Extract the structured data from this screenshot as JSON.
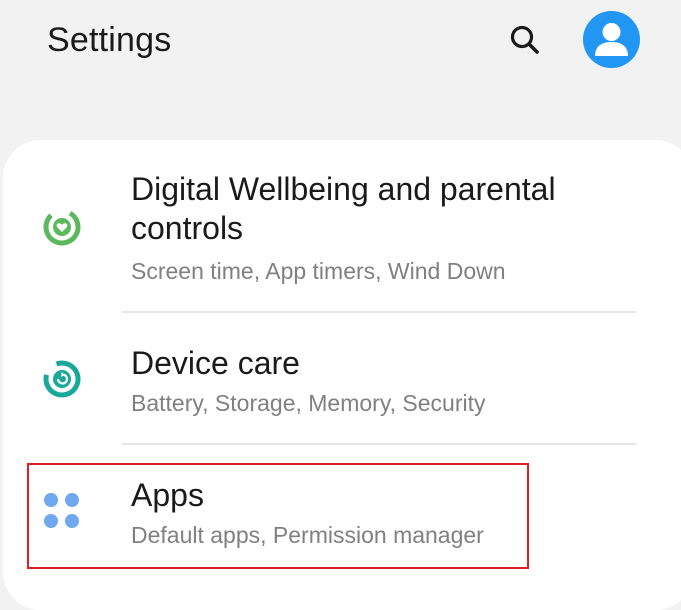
{
  "header": {
    "title": "Settings",
    "search_icon": "search-icon",
    "account_icon": "account-avatar-icon"
  },
  "colors": {
    "background": "#f2f2f2",
    "card": "#ffffff",
    "avatar": "#2196f3",
    "wellbeing_icon": "#5cb85c",
    "device_care_icon": "#1aa89a",
    "apps_icon": "#6fa8ee",
    "highlight": "#e02020"
  },
  "settings": {
    "items": [
      {
        "title": "Digital Wellbeing and parental controls",
        "subtitle": "Screen time, App timers, Wind Down",
        "icon": "digital-wellbeing-icon"
      },
      {
        "title": "Device care",
        "subtitle": "Battery, Storage, Memory, Security",
        "icon": "device-care-icon"
      },
      {
        "title": "Apps",
        "subtitle": "Default apps, Permission manager",
        "icon": "apps-icon"
      }
    ]
  }
}
